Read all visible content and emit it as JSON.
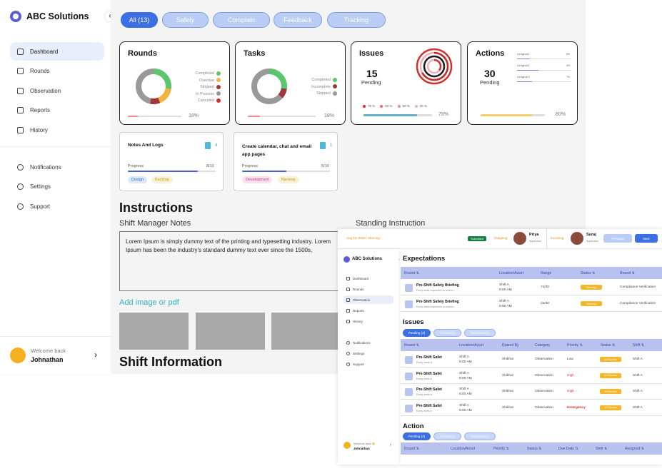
{
  "sidebar": {
    "brand": "ABC Solutions",
    "collapse": "‹",
    "items": [
      {
        "label": "Dashboard",
        "icon": "grid-icon"
      },
      {
        "label": "Rounds",
        "icon": "inbox-icon"
      },
      {
        "label": "Observation",
        "icon": "calendar-icon"
      },
      {
        "label": "Reports",
        "icon": "presentation-icon"
      },
      {
        "label": "History",
        "icon": "clock-icon"
      }
    ],
    "items2": [
      {
        "label": "Notifications",
        "icon": "bell-icon"
      },
      {
        "label": "Settings",
        "icon": "gear-icon"
      },
      {
        "label": "Support",
        "icon": "info-icon"
      }
    ],
    "user": {
      "greet": "Welcome back",
      "name": "Johnathan",
      "arrow": "›"
    }
  },
  "filters": [
    "All (13)",
    "Safety",
    "Complain",
    "Feedback",
    "Tracking"
  ],
  "cards": {
    "rounds": {
      "title": "Rounds",
      "legend": [
        "Completed",
        "Overdue",
        "Skipped",
        "In Process",
        "Canceled"
      ],
      "colors": [
        "#5bc66c",
        "#f2b53a",
        "#a1373a",
        "#9a9a9a",
        "#d82d2d"
      ],
      "pct": "18%",
      "progress": 0.18
    },
    "tasks": {
      "title": "Tasks",
      "legend": [
        "Completed",
        "Incomplete",
        "Skipped"
      ],
      "colors": [
        "#5bc66c",
        "#a1373a",
        "#9a9a9a"
      ],
      "pct": "18%",
      "progress": 0.18
    },
    "issues": {
      "title": "Issues",
      "count": "15",
      "sub": "Pending",
      "legend": [
        "75 %",
        "50 %",
        "50 %",
        "25 %"
      ],
      "pct": "78%",
      "progress": 0.78
    },
    "actions": {
      "title": "Actions",
      "count": "30",
      "sub": "Pending",
      "legend": [
        {
          "l": "● Legend 1",
          "v": "5%"
        },
        {
          "l": "● Legend 2",
          "v": "4%"
        },
        {
          "l": "● Legend 3",
          "v": "7%"
        }
      ],
      "pct": "80%",
      "progress": 0.8
    }
  },
  "notes": [
    {
      "title": "Notes And Logs",
      "count": "4",
      "prog_label": "Progress",
      "prog": "8/10",
      "progress": 0.8,
      "tags": [
        "Design",
        "Backlog"
      ]
    },
    {
      "title": "Create calendar, chat and email app pages",
      "count": "1",
      "prog_label": "Progress",
      "prog": "5/10",
      "progress": 0.5,
      "tags": [
        "Development",
        "Backlog"
      ]
    }
  ],
  "instructions": {
    "title": "Instructions",
    "shift_notes": "Shift Manager Notes",
    "standing": "Standing Instruction",
    "text": "Lorem Ipsum is simply dummy text of the printing and typesetting industry. Lorem Ipsum has been the industry's standard dummy text ever since the 1500s,",
    "add": "Add image or pdf",
    "shift_info": "Shift Information"
  },
  "overlay": {
    "date": "Aug 12, 2024 / Morning",
    "submitted": "Submitted",
    "outgoing": "Outgoing",
    "out_name": "Priya",
    "out_role": "Supervisor",
    "incoming": "Incoming",
    "in_name": "Suraj",
    "in_role": "Supervisor",
    "prev": "Previous",
    "next": "Next",
    "brand": "ABC Solutions",
    "nav": [
      "Dashboard",
      "Rounds",
      "Observation",
      "Reports",
      "History"
    ],
    "nav2": [
      "Notifications",
      "Settings",
      "Support"
    ],
    "user": {
      "greet": "Welcome back 👋",
      "name": "Johnathan"
    },
    "expect": {
      "title": "Expectations",
      "cols": [
        "Round ⇅",
        "Location/Asset",
        "Range",
        "Status ⇅",
        "Round ⇅"
      ],
      "rows": [
        {
          "t": "Pre-Shift Safety Briefing",
          "s": "Every week inspection to control...",
          "loc": "Shift A",
          "time": "6:00 AM",
          "range": "74/30",
          "status": "Warning",
          "round": "Compliance Verification"
        },
        {
          "t": "Pre-Shift Safety Briefing",
          "s": "Every week inspection to control...",
          "loc": "Shift A",
          "time": "6:00 AM",
          "range": "24/30",
          "status": "Warning",
          "round": "Compliance Verification"
        }
      ]
    },
    "issues": {
      "title": "Issues",
      "tabs": [
        "Pending (2)",
        "Solved (3)",
        "Resolved (2)"
      ],
      "cols": [
        "Round ⇅",
        "Location/Asset",
        "Raised By",
        "Category",
        "Priority ⇅",
        "Status ⇅",
        "Shift ⇅"
      ],
      "rows": [
        {
          "t": "Pre-Shift Safet",
          "s": "Every week in",
          "loc": "Shift A",
          "time": "6:00 AM",
          "by": "Shikhar",
          "cat": "Observation",
          "pri": "Low",
          "status": "In Process",
          "shift": "Shift A"
        },
        {
          "t": "Pre-Shift Safet",
          "s": "Every week in",
          "loc": "Shift A",
          "time": "6:00 AM",
          "by": "Shikhar",
          "cat": "Observation",
          "pri": "High",
          "status": "In Process",
          "shift": "Shift A"
        },
        {
          "t": "Pre-Shift Safet",
          "s": "Every week in",
          "loc": "Shift A",
          "time": "6:00 AM",
          "by": "Shikhar",
          "cat": "Observation",
          "pri": "High",
          "status": "In Process",
          "shift": "Shift A"
        },
        {
          "t": "Pre-Shift Safet",
          "s": "Every week in",
          "loc": "Shift A",
          "time": "6:00 AM",
          "by": "Shikhar",
          "cat": "Observation",
          "pri": "Emergency",
          "status": "In Process",
          "shift": "Shift A"
        }
      ]
    },
    "action": {
      "title": "Action",
      "tabs": [
        "Pending (2)",
        "Solved (3)",
        "Resolved (2)"
      ],
      "cols": [
        "Round ⇅",
        "Location/Asset",
        "Priority ⇅",
        "Status ⇅",
        "Due Date ⇅",
        "Shift ⇅",
        "Assigned ⇅"
      ]
    }
  }
}
